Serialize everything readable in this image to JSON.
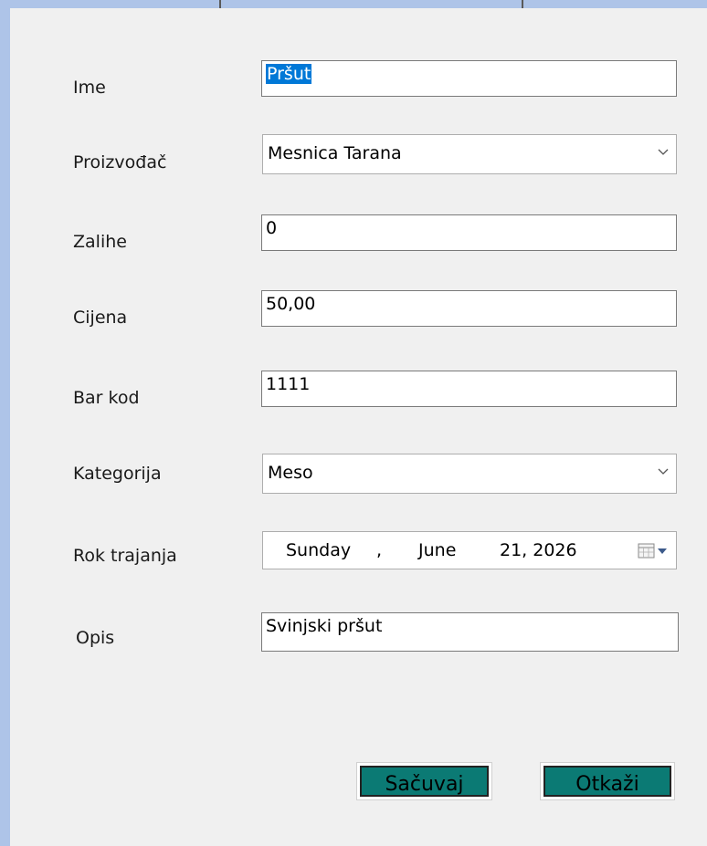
{
  "form": {
    "fields": {
      "ime": {
        "label": "Ime",
        "value": "Pršut"
      },
      "proizvodac": {
        "label": "Proizvođač",
        "value": "Mesnica Tarana"
      },
      "zalihe": {
        "label": "Zalihe",
        "value": "0"
      },
      "cijena": {
        "label": "Cijena",
        "value": "50,00"
      },
      "bar_kod": {
        "label": "Bar kod",
        "value": "1111"
      },
      "kategorija": {
        "label": "Kategorija",
        "value": "Meso"
      },
      "rok_trajanja": {
        "label": "Rok trajanja",
        "weekday": "Sunday",
        "separator": ",",
        "month": "June",
        "day_year": "21, 2026"
      },
      "opis": {
        "label": "Opis",
        "value": "Svinjski pršut"
      }
    },
    "buttons": {
      "save_label": "Sačuvaj",
      "cancel_label": "Otkaži"
    },
    "colors": {
      "button_fill": "#0b7a74",
      "selection": "#0078d7",
      "background": "#f0f0f0",
      "frame": "#aec4e8"
    },
    "icons": {
      "dropdown": "chevron-down-icon",
      "calendar": "calendar-icon"
    }
  }
}
